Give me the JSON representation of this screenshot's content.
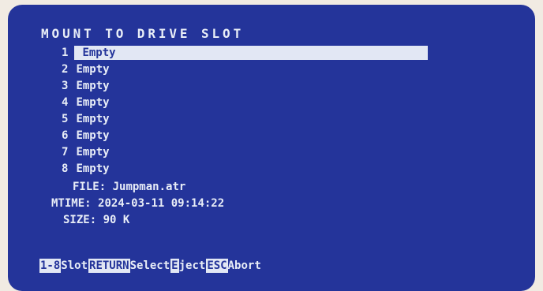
{
  "title": "MOUNT TO DRIVE SLOT",
  "slots": [
    {
      "num": "1",
      "label": "Empty"
    },
    {
      "num": "2",
      "label": "Empty"
    },
    {
      "num": "3",
      "label": "Empty"
    },
    {
      "num": "4",
      "label": "Empty"
    },
    {
      "num": "5",
      "label": "Empty"
    },
    {
      "num": "6",
      "label": "Empty"
    },
    {
      "num": "7",
      "label": "Empty"
    },
    {
      "num": "8",
      "label": "Empty"
    }
  ],
  "selected_slot": 1,
  "info": {
    "file_label": "FILE:",
    "file_value": "Jumpman.atr",
    "mtime_label": "MTIME:",
    "mtime_value": "2024-03-11 09:14:22",
    "size_label": "SIZE:",
    "size_value": "90 K"
  },
  "footer": {
    "slot_key": "1-8",
    "slot_label": "Slot",
    "select_key": "RETURN",
    "select_label": "Select",
    "eject_key": "E",
    "eject_label": "ject",
    "abort_key": "ESC",
    "abort_label": "Abort"
  },
  "colors": {
    "background": "#24349a",
    "foreground": "#e8edf7",
    "highlight": "#e2e7f4",
    "page": "#f1ebe3"
  }
}
